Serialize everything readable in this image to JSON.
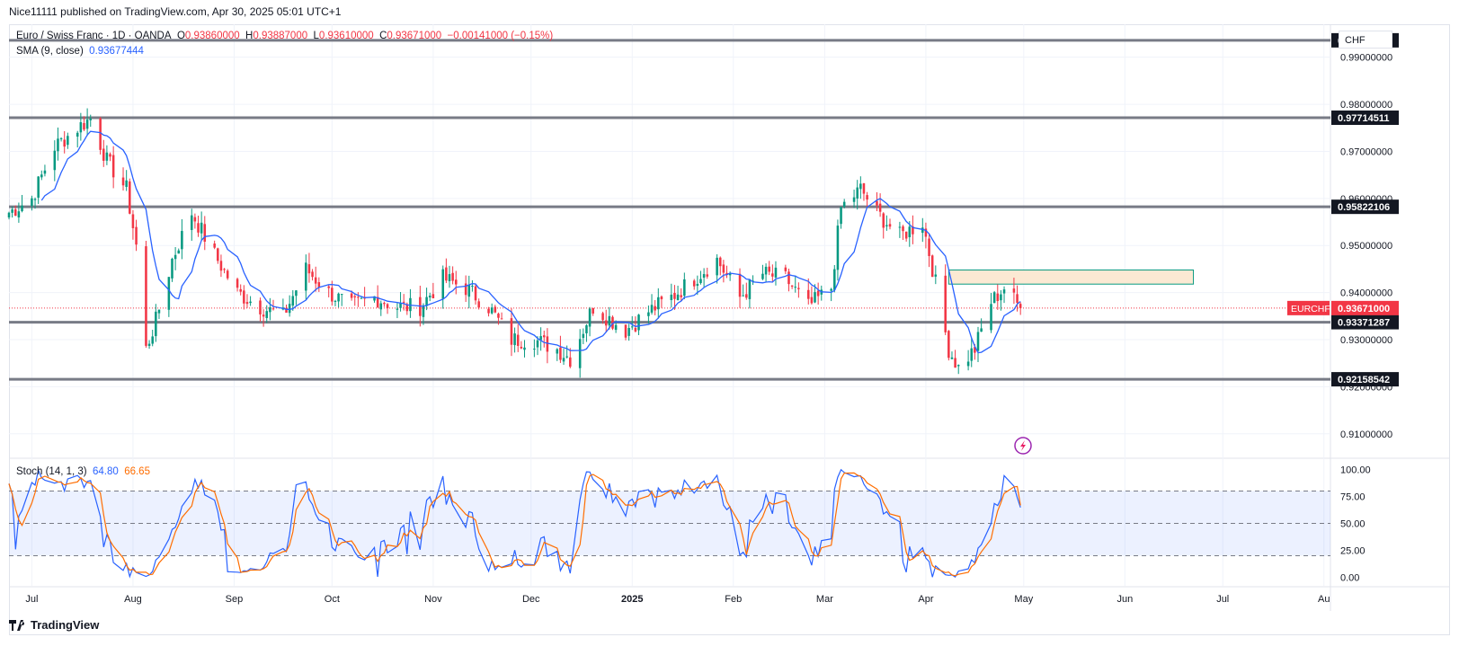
{
  "header": {
    "published": "Nice11111 published on TradingView.com, Apr 30, 2025 05:01 UTC+1"
  },
  "legend": {
    "symbol": "Euro / Swiss Franc · 1D · OANDA",
    "o_label": "O",
    "o": "0.93860000",
    "h_label": "H",
    "h": "0.93887000",
    "l_label": "L",
    "l": "0.93610000",
    "c_label": "C",
    "c": "0.93671000",
    "change": "−0.00141000 (−0.15%)",
    "sma_label": "SMA (9, close)",
    "sma_value": "0.93677444",
    "stoch_label": "Stoch (14, 1, 3)",
    "stoch_k": "64.80",
    "stoch_d": "66.65"
  },
  "currency_button": "CHF",
  "footer": {
    "brand": "TradingView",
    "logo_icon": "tradingview-logo-icon"
  },
  "colors": {
    "up": "#089981",
    "down": "#f23645",
    "sma": "#2962ff",
    "stoch_k": "#2962ff",
    "stoch_d": "#ff6d00",
    "level": "#787b86",
    "zone_fill": "#fbe9d3",
    "zone_border": "#089981",
    "price_label": "#f23645"
  },
  "chart_data": [
    {
      "type": "candlestick",
      "symbol": "EURCHF",
      "x_axis": {
        "labels": [
          "Jul",
          "Aug",
          "Sep",
          "Oct",
          "Nov",
          "Dec",
          "2025",
          "Feb",
          "Mar",
          "Apr",
          "May",
          "Jun",
          "Jul",
          "Au"
        ]
      },
      "y_axis": {
        "min": 0.905,
        "max": 0.997,
        "ticks": [
          0.91,
          0.92,
          0.93,
          0.94,
          0.95,
          0.96,
          0.97,
          0.98,
          0.99
        ],
        "tick_labels": [
          "0.91000000",
          "0.92000000",
          "0.93000000",
          "0.94000000",
          "0.95000000",
          "0.96000000",
          "0.97000000",
          "0.98000000",
          "0.99000000"
        ]
      },
      "horizontal_levels": [
        {
          "value": 0.99358731,
          "label": "0.99358731"
        },
        {
          "value": 0.97714511,
          "label": "0.97714511"
        },
        {
          "value": 0.95822106,
          "label": "0.95822106"
        },
        {
          "value": 0.93371287,
          "label": "0.93371287"
        },
        {
          "value": 0.92158542,
          "label": "0.92158542"
        }
      ],
      "current_price": {
        "symbol": "EURCHF",
        "value": 0.93671,
        "label": "0.93671000"
      },
      "zone": {
        "from": "2025-04-08",
        "to": "2025-06-22",
        "low": 0.9418,
        "high": 0.9448
      },
      "anchors": [
        [
          "2024-06-24",
          0.957
        ],
        [
          "2024-07-01",
          0.96
        ],
        [
          "2024-07-08",
          0.971
        ],
        [
          "2024-07-15",
          0.975
        ],
        [
          "2024-07-19",
          0.977
        ],
        [
          "2024-07-24",
          0.968
        ],
        [
          "2024-07-30",
          0.962
        ],
        [
          "2024-08-02",
          0.95
        ],
        [
          "2024-08-05",
          0.928
        ],
        [
          "2024-08-08",
          0.934
        ],
        [
          "2024-08-13",
          0.947
        ],
        [
          "2024-08-19",
          0.957
        ],
        [
          "2024-08-26",
          0.948
        ],
        [
          "2024-09-02",
          0.94
        ],
        [
          "2024-09-09",
          0.937
        ],
        [
          "2024-09-16",
          0.935
        ],
        [
          "2024-09-23",
          0.945
        ],
        [
          "2024-09-30",
          0.94
        ],
        [
          "2024-10-07",
          0.937
        ],
        [
          "2024-10-14",
          0.939
        ],
        [
          "2024-10-21",
          0.937
        ],
        [
          "2024-10-28",
          0.937
        ],
        [
          "2024-11-04",
          0.943
        ],
        [
          "2024-11-11",
          0.941
        ],
        [
          "2024-11-18",
          0.937
        ],
        [
          "2024-11-25",
          0.93
        ],
        [
          "2024-12-02",
          0.93
        ],
        [
          "2024-12-09",
          0.928
        ],
        [
          "2024-12-13",
          0.926
        ],
        [
          "2024-12-20",
          0.937
        ],
        [
          "2024-12-30",
          0.932
        ],
        [
          "2025-01-06",
          0.936
        ],
        [
          "2025-01-13",
          0.939
        ],
        [
          "2025-01-20",
          0.943
        ],
        [
          "2025-01-27",
          0.947
        ],
        [
          "2025-02-03",
          0.939
        ],
        [
          "2025-02-10",
          0.944
        ],
        [
          "2025-02-17",
          0.943
        ],
        [
          "2025-02-24",
          0.937
        ],
        [
          "2025-03-03",
          0.941
        ],
        [
          "2025-03-06",
          0.958
        ],
        [
          "2025-03-12",
          0.962
        ],
        [
          "2025-03-17",
          0.957
        ],
        [
          "2025-03-24",
          0.952
        ],
        [
          "2025-03-31",
          0.955
        ],
        [
          "2025-04-04",
          0.942
        ],
        [
          "2025-04-08",
          0.928
        ],
        [
          "2025-04-11",
          0.924
        ],
        [
          "2025-04-16",
          0.928
        ],
        [
          "2025-04-21",
          0.938
        ],
        [
          "2025-04-25",
          0.941
        ],
        [
          "2025-04-30",
          0.9367
        ]
      ]
    },
    {
      "type": "line",
      "name": "Stoch (14, 1, 3)",
      "y_axis": {
        "min": -8,
        "max": 108,
        "ticks": [
          0,
          25,
          50,
          75,
          100
        ],
        "tick_labels": [
          "0.00",
          "25.00",
          "50.00",
          "75.00",
          "100.00"
        ]
      },
      "band": {
        "lower": 20,
        "upper": 80,
        "middle": 50
      },
      "last_k": 64.8,
      "last_d": 66.65
    }
  ]
}
